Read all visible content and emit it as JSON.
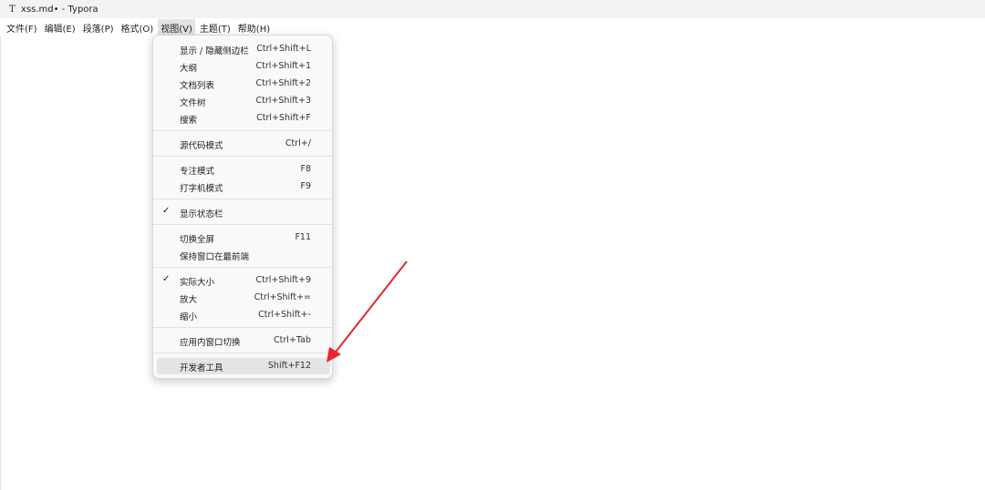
{
  "window": {
    "icon": "T",
    "title": "xss.md• - Typora"
  },
  "menubar": [
    {
      "label": "文件(F)"
    },
    {
      "label": "编辑(E)"
    },
    {
      "label": "段落(P)"
    },
    {
      "label": "格式(O)"
    },
    {
      "label": "视图(V)"
    },
    {
      "label": "主题(T)"
    },
    {
      "label": "帮助(H)"
    }
  ],
  "view_menu": [
    {
      "label": "显示 / 隐藏侧边栏",
      "shortcut": "Ctrl+Shift+L"
    },
    {
      "label": "大纲",
      "shortcut": "Ctrl+Shift+1"
    },
    {
      "label": "文档列表",
      "shortcut": "Ctrl+Shift+2"
    },
    {
      "label": "文件树",
      "shortcut": "Ctrl+Shift+3"
    },
    {
      "label": "搜索",
      "shortcut": "Ctrl+Shift+F"
    },
    {
      "label": "源代码模式",
      "shortcut": "Ctrl+/"
    },
    {
      "label": "专注模式",
      "shortcut": "F8"
    },
    {
      "label": "打字机模式",
      "shortcut": "F9"
    },
    {
      "label": "显示状态栏",
      "shortcut": "",
      "checked": true
    },
    {
      "label": "切换全屏",
      "shortcut": "F11"
    },
    {
      "label": "保持窗口在最前端",
      "shortcut": ""
    },
    {
      "label": "实际大小",
      "shortcut": "Ctrl+Shift+9",
      "checked": true
    },
    {
      "label": "放大",
      "shortcut": "Ctrl+Shift+="
    },
    {
      "label": "缩小",
      "shortcut": "Ctrl+Shift+-"
    },
    {
      "label": "应用内窗口切换",
      "shortcut": "Ctrl+Tab"
    },
    {
      "label": "开发者工具",
      "shortcut": "Shift+F12",
      "highlighted": true
    }
  ],
  "check_glyph": "✓",
  "annotation": {
    "color": "#e8262a"
  }
}
